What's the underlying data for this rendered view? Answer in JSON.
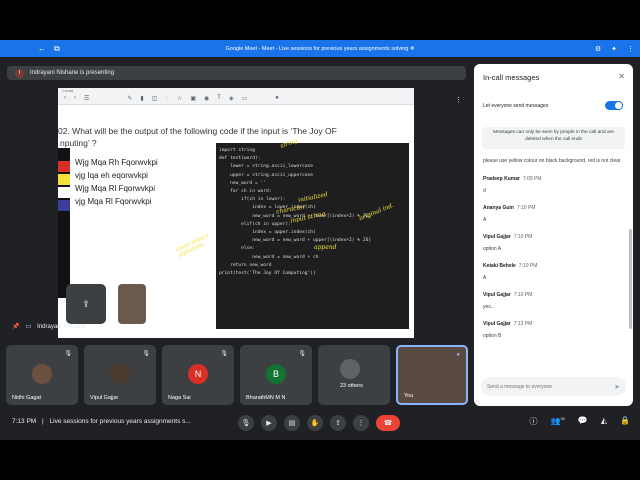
{
  "browser": {
    "tab_title": "Google Meet - Meet - Live sessions for previous years assignments solving ❄"
  },
  "presenting": {
    "avatar_letter": "I",
    "text": "Indrayani Nishane is presenting"
  },
  "shared_screen": {
    "question_line1": "02.  What will be the output of the following code if the input is ‘The Joy OF",
    "question_line2": "nputing’ ?",
    "options": [
      "Wjg Mqa Rh Fqorwvkpi",
      "vjg Iqa eh eqorwvkpi",
      "Wjg Mqa Rl Fqorwvkpi",
      "vjg Mqa Rl Fqorwvkpi"
    ],
    "code_lines": [
      "import string",
      "",
      "def test(word):",
      "",
      "    lower = string.ascii_lowercase",
      "    upper = string.ascii_uppercase",
      "",
      "    new_word = ''",
      "    for ch in word:",
      "        if(ch in lower):",
      "            index = lower.index(ch)",
      "            new_word = new_word + lower[(index+2) % 26]",
      "",
      "        elif(ch in upper):",
      "            index = upper.index(ch)",
      "            new_word = new_word + upper[(index+2) % 26]",
      "",
      "        else:",
      "            new_word = new_word + ch",
      "",
      "    return new_word",
      "",
      "print(test('The Joy Of Computing'))"
    ],
    "annotations": {
      "string": "string",
      "character": "character",
      "initialized": "initialized",
      "input_string": "input string",
      "lower_letters": "lower letters alphabets",
      "original_index": "original ind.",
      "append": "append"
    },
    "presenter_label": "Indrayani Nishane"
  },
  "participants": [
    {
      "name": "Nidhi Gagat",
      "type": "photo"
    },
    {
      "name": "Vipul Gajjar",
      "type": "photo"
    },
    {
      "name": "Naga Sai",
      "type": "letter",
      "letter": "N",
      "color": "#d93025"
    },
    {
      "name": "BharathMN M N",
      "type": "letter",
      "letter": "B",
      "color": "#137333"
    },
    {
      "name": "23 others",
      "type": "others"
    },
    {
      "name": "You",
      "type": "self"
    }
  ],
  "bottom_bar": {
    "time": "7:13 PM",
    "separator": "|",
    "meeting_title": "Live sessions for previous years assignments s...",
    "participant_count": "30"
  },
  "chat": {
    "header": "In-call messages",
    "let_everyone_send": "Let everyone send messages",
    "notice": "Messages can only be seen by people in the call and are deleted when the call ends",
    "first_text": "please use yellow colour on black background, red is not clear",
    "messages": [
      {
        "sender": "Pradeep Kumar",
        "time": "7:09 PM",
        "text": "d"
      },
      {
        "sender": "Ananya Guin",
        "time": "7:10 PM",
        "text": "A"
      },
      {
        "sender": "Vipul Gajjar",
        "time": "7:10 PM",
        "text": "option A"
      },
      {
        "sender": "Ketaki Behele",
        "time": "7:10 PM",
        "text": "A"
      },
      {
        "sender": "Vipul Gajjar",
        "time": "7:10 PM",
        "text": "yes.."
      },
      {
        "sender": "Vipul Gajjar",
        "time": "7:13 PM",
        "text": "option B"
      }
    ],
    "input_placeholder": "Send a message to everyone"
  }
}
